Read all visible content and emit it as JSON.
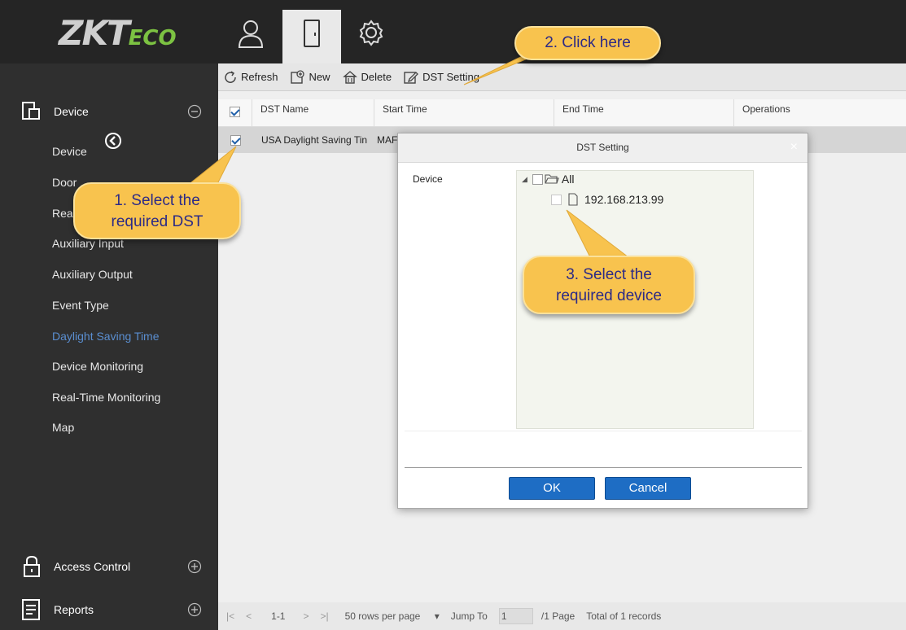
{
  "brand": {
    "logo_main": "ZKT",
    "logo_suffix": "ECO"
  },
  "topnav": [
    {
      "icon": "person-icon"
    },
    {
      "icon": "door-icon"
    },
    {
      "icon": "gear-icon"
    }
  ],
  "sidebar": {
    "module_device": "Device",
    "items": [
      "Device",
      "Door",
      "Reader",
      "Auxiliary Input",
      "Auxiliary Output",
      "Event Type",
      "Daylight Saving Time",
      "Device Monitoring",
      "Real-Time Monitoring",
      "Map"
    ],
    "selected": "Daylight Saving Time",
    "module_access": "Access Control",
    "module_reports": "Reports"
  },
  "toolbar": {
    "refresh": "Refresh",
    "new": "New",
    "delete": "Delete",
    "dst_setting": "DST Setting"
  },
  "table": {
    "columns": [
      "DST Name",
      "Start Time",
      "End Time",
      "Operations"
    ],
    "rows": [
      {
        "dst_name": "USA Daylight Saving Tin",
        "start_time": "MAF",
        "checked": true
      }
    ]
  },
  "pager": {
    "first": "|<",
    "prev": "<",
    "range": "1-1",
    "next": ">",
    "last": ">|",
    "rows_per_page": "50 rows per page",
    "jump_to": "Jump To",
    "page_value": "1",
    "page_of": "/1 Page",
    "total": "Total of 1 records"
  },
  "dialog": {
    "title": "DST Setting",
    "close": "×",
    "device_label": "Device",
    "tree_root": "All",
    "tree_child": "192.168.213.99",
    "ok": "OK",
    "cancel": "Cancel"
  },
  "callouts": {
    "c1_line1": "1. Select the",
    "c1_line2": "required DST",
    "c2": "2. Click here",
    "c3_line1": "3. Select the",
    "c3_line2": "required device"
  },
  "colors": {
    "accent": "#1e6dc4",
    "callout": "#f8c34e",
    "selected_nav": "#5a8ed0"
  }
}
